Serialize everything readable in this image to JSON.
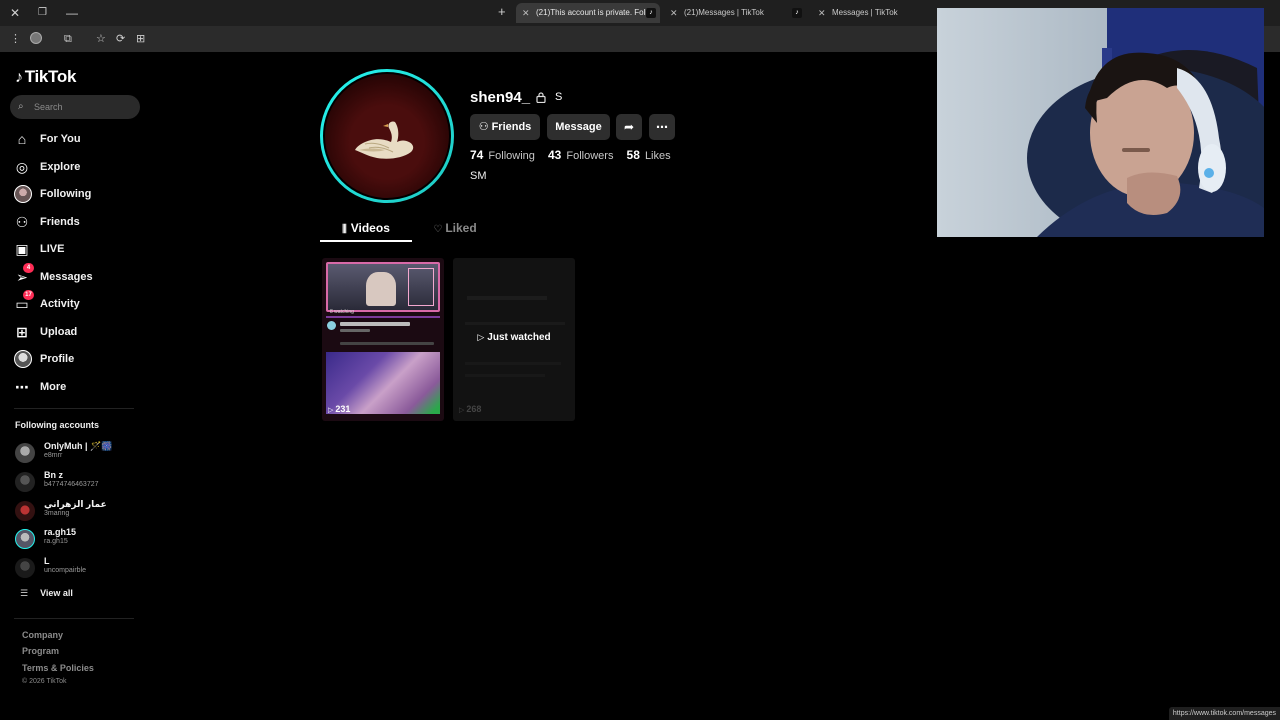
{
  "browser": {
    "tabs": [
      {
        "title": "(21)This account is private. Follo",
        "active": true
      },
      {
        "title": "(21)Messages | TikTok",
        "active": false
      },
      {
        "title": "Messages | TikTok",
        "active": false
      }
    ],
    "status_url": "https://www.tiktok.com/messages"
  },
  "sidebar": {
    "logo": "TikTok",
    "search_placeholder": "Search",
    "nav": [
      {
        "label": "For You",
        "icon": "home-icon"
      },
      {
        "label": "Explore",
        "icon": "compass-icon"
      },
      {
        "label": "Following",
        "icon": "avatar"
      },
      {
        "label": "Friends",
        "icon": "friends-icon"
      },
      {
        "label": "LIVE",
        "icon": "live-icon"
      },
      {
        "label": "Messages",
        "icon": "messages-icon",
        "badge": "4"
      },
      {
        "label": "Activity",
        "icon": "activity-icon",
        "badge": "17"
      },
      {
        "label": "Upload",
        "icon": "upload-icon"
      },
      {
        "label": "Profile",
        "icon": "avatar"
      },
      {
        "label": "More",
        "icon": "more-icon"
      }
    ],
    "following_accounts_title": "Following accounts",
    "following_accounts": [
      {
        "name": "OnlyMuh | 🪄🎆",
        "handle": "e8mrr"
      },
      {
        "name": "Bn z",
        "handle": "b4774746463727"
      },
      {
        "name": "عمار الزهراني",
        "handle": "3maring"
      },
      {
        "name": "ra.gh15",
        "handle": "ra.gh15"
      },
      {
        "name": "L",
        "handle": "uncompairble"
      }
    ],
    "view_all": "View all",
    "footer": {
      "links": [
        "Company",
        "Program",
        "Terms & Policies"
      ],
      "copyright": "© 2026 TikTok"
    }
  },
  "profile": {
    "username": "shen94_",
    "nickname": "S",
    "buttons": {
      "friends": "Friends",
      "message": "Message"
    },
    "stats": {
      "following_count": "74",
      "following_label": "Following",
      "followers_count": "43",
      "followers_label": "Followers",
      "likes_count": "58",
      "likes_label": "Likes"
    },
    "bio": "SM",
    "tabs": {
      "videos": "Videos",
      "liked": "Liked"
    },
    "videos": [
      {
        "views": "231",
        "watching": "8 watching"
      },
      {
        "views": "268",
        "overlay": "Just watched"
      }
    ]
  },
  "colors": {
    "accent": "#fe2c55",
    "ring": "#25f4ee",
    "background": "#000000"
  }
}
